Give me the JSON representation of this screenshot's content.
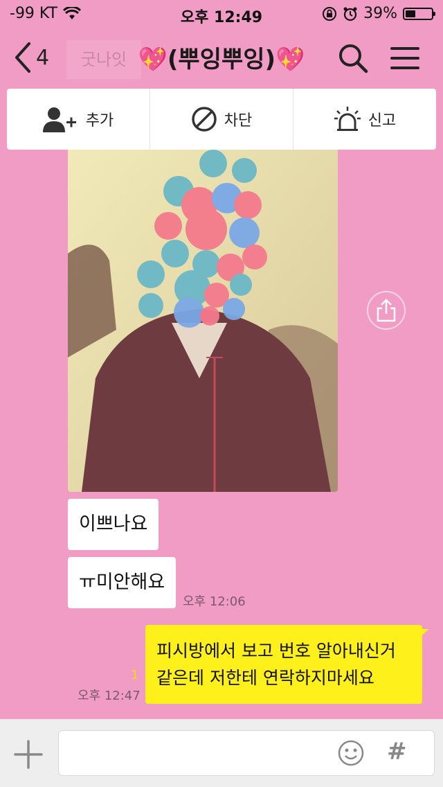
{
  "status_bar": {
    "carrier": "-99 KT",
    "time": "오후 12:49",
    "battery": "39%",
    "battery_level": 0.39
  },
  "ghost_message": "굿나잇",
  "header": {
    "back_count": "4",
    "title": "(뿌잉뿌잉)",
    "title_emoji": "💖",
    "title_emoji_right": "💖"
  },
  "actions": [
    {
      "label": "추가",
      "icon": "add-friend-icon"
    },
    {
      "label": "차단",
      "icon": "block-icon"
    },
    {
      "label": "신고",
      "icon": "siren-icon"
    }
  ],
  "messages": {
    "incoming": [
      {
        "text": "이쁘나요"
      },
      {
        "text": "ㅠ미안해요",
        "time": "오후 12:06"
      }
    ],
    "outgoing": {
      "line1": "피시방에서 보고 번호 알아내신거",
      "line2": "같은데 저한테 연락하지마세요",
      "unread": "1",
      "time": "오후 12:47"
    }
  },
  "input_bar": {
    "value": "",
    "hash": "#"
  },
  "colors": {
    "background": "#f09cc4",
    "outgoing_bubble": "#fef01b",
    "incoming_bubble": "#ffffff"
  }
}
